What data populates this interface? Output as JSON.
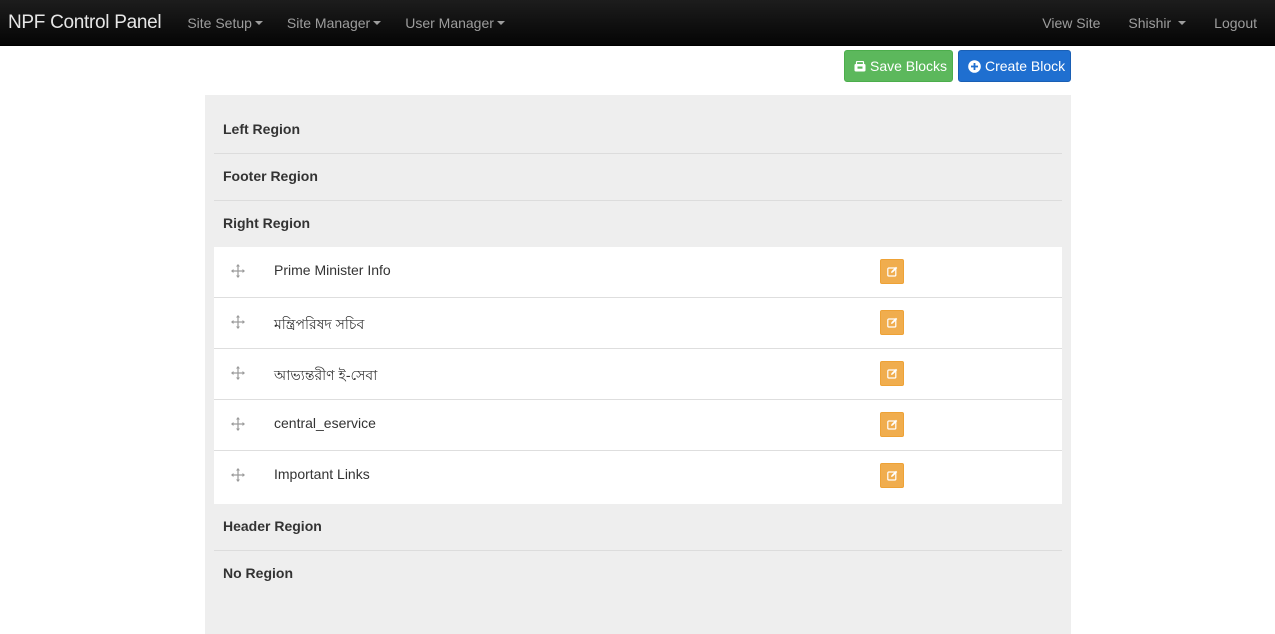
{
  "navbar": {
    "brand": "NPF Control Panel",
    "menus": [
      "Site Setup",
      "Site Manager",
      "User Manager"
    ],
    "view_site": "View Site",
    "user": "Shishir",
    "logout": "Logout",
    "background_color": "#0f0f0f",
    "text_color": "#9d9d9d"
  },
  "actions": {
    "save_label": "Save Blocks",
    "save_icon": "save-icon",
    "save_color": "#5cb85c",
    "create_label": "Create Block",
    "create_icon": "plus-circle-icon",
    "create_color": "#1f6fd0"
  },
  "regions": {
    "left": "Left Region",
    "footer": "Footer Region",
    "right": "Right Region",
    "header": "Header Region",
    "none": "No Region"
  },
  "right_region_blocks": [
    {
      "name": "Prime Minister Info",
      "drag_icon": "move-icon",
      "edit_icon": "edit-icon"
    },
    {
      "name": "মন্ত্রিপরিষদ সচিব",
      "drag_icon": "move-icon",
      "edit_icon": "edit-icon"
    },
    {
      "name": "আভ্যন্তরীণ ই-সেবা",
      "drag_icon": "move-icon",
      "edit_icon": "edit-icon"
    },
    {
      "name": "central_eservice",
      "drag_icon": "move-icon",
      "edit_icon": "edit-icon"
    },
    {
      "name": "Important Links",
      "drag_icon": "move-icon",
      "edit_icon": "edit-icon"
    }
  ],
  "edit_button_color": "#f0ad4e"
}
